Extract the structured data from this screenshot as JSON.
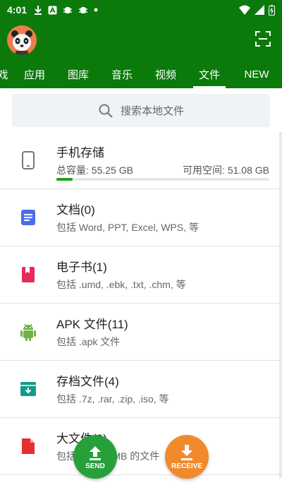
{
  "status_bar": {
    "time": "4:01",
    "notification_icons": [
      "download-icon",
      "a-icon",
      "bug-icon",
      "bug-icon",
      "dot-icon"
    ]
  },
  "header": {
    "tabs": [
      {
        "label": "戏",
        "active": false
      },
      {
        "label": "应用",
        "active": false
      },
      {
        "label": "图库",
        "active": false
      },
      {
        "label": "音乐",
        "active": false
      },
      {
        "label": "视频",
        "active": false
      },
      {
        "label": "文件",
        "active": true
      },
      {
        "label": "NEW",
        "active": false
      }
    ]
  },
  "search": {
    "placeholder": "搜索本地文件"
  },
  "storage": {
    "title": "手机存储",
    "total_label": "总容量: 55.25 GB",
    "free_label": "可用空间: 51.08 GB",
    "used_fraction": 0.075
  },
  "categories": [
    {
      "title": "文档(0)",
      "subtitle": "包括 Word, PPT, Excel, WPS, 等",
      "icon": "document-icon",
      "color": "#4a6cf0"
    },
    {
      "title": "电子书(1)",
      "subtitle": "包括 .umd, .ebk, .txt, .chm, 等",
      "icon": "ebook-icon",
      "color": "#e52b5a"
    },
    {
      "title": "APK 文件(11)",
      "subtitle": "包括 .apk 文件",
      "icon": "android-icon",
      "color": "#6fb244"
    },
    {
      "title": "存档文件(4)",
      "subtitle": "包括 .7z, .rar, .zip, .iso, 等",
      "icon": "archive-icon",
      "color": "#139a8c"
    },
    {
      "title": "大文件(9)",
      "subtitle": "包括大于 50 MB 的文件",
      "icon": "large-file-icon",
      "color": "#e53030"
    }
  ],
  "fab": {
    "send_label": "SEND",
    "receive_label": "RECEIVE"
  },
  "colors": {
    "primary": "#0b7a0b",
    "send": "#27a03a",
    "receive": "#f3892d"
  }
}
